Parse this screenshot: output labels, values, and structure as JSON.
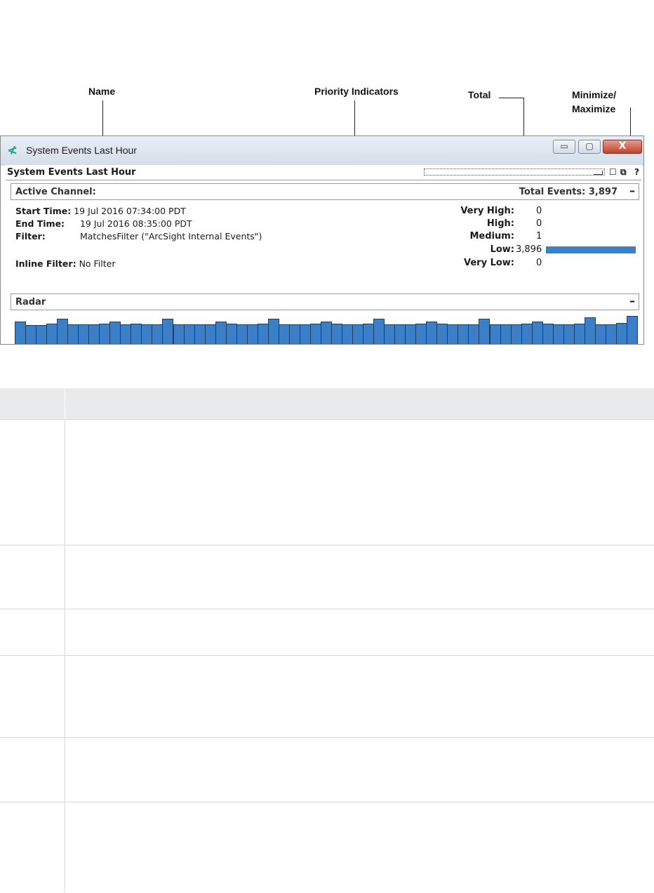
{
  "callouts": {
    "name": "Name",
    "priority": "Priority Indicators",
    "total": "Total",
    "minmax_line1": "Minimize/",
    "minmax_line2": "Maximize"
  },
  "window": {
    "title": "System Events Last Hour",
    "minimize_glyph": "▭",
    "maximize_glyph": "▢",
    "close_glyph": "X"
  },
  "panel": {
    "name": "System Events Last Hour",
    "controls": [
      "☐",
      "⧉",
      "?"
    ]
  },
  "active_channel": {
    "label": "Active Channel:",
    "total_events": "Total Events: 3,897",
    "collapse_glyph": "–",
    "start_label": "Start Time:",
    "start_value": "19 Jul 2016 07:34:00 PDT",
    "end_label": "End Time:",
    "end_value": "19 Jul 2016 08:35:00 PDT",
    "filter_label": "Filter:",
    "filter_value": "MatchesFilter (\"ArcSight Internal Events\")",
    "inline_label": "Inline Filter:",
    "inline_value": "No Filter"
  },
  "priority": [
    {
      "label": "Very High:",
      "value": "0"
    },
    {
      "label": "High:",
      "value": "0"
    },
    {
      "label": "Medium:",
      "value": "1"
    },
    {
      "label": "Low:",
      "value": "3,896"
    },
    {
      "label": "Very Low:",
      "value": "0"
    }
  ],
  "radar": {
    "label": "Radar",
    "collapse_glyph": "–",
    "bar_color": "#3b7fc8",
    "bar_levels": [
      0.82,
      0.7,
      0.7,
      0.75,
      0.9,
      0.72,
      0.72,
      0.72,
      0.76,
      0.82,
      0.72,
      0.76,
      0.72,
      0.72,
      0.9,
      0.72,
      0.72,
      0.72,
      0.72,
      0.82,
      0.76,
      0.72,
      0.72,
      0.76,
      0.9,
      0.72,
      0.72,
      0.72,
      0.76,
      0.82,
      0.76,
      0.72,
      0.72,
      0.76,
      0.9,
      0.72,
      0.72,
      0.72,
      0.76,
      0.82,
      0.76,
      0.72,
      0.72,
      0.72,
      0.9,
      0.72,
      0.72,
      0.72,
      0.76,
      0.82,
      0.76,
      0.72,
      0.72,
      0.76,
      0.95,
      0.72,
      0.72,
      0.78,
      1.0
    ]
  },
  "colors": {
    "low_bar": "#3b7fc8",
    "table_header": "#e9eaeb"
  }
}
